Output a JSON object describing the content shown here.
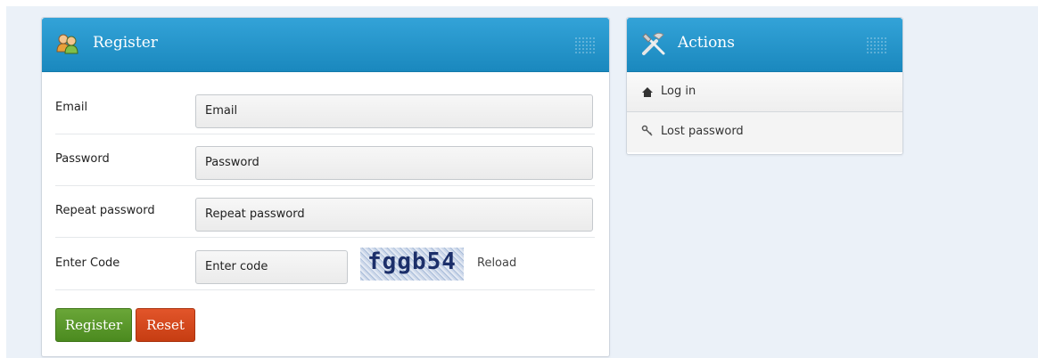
{
  "register": {
    "title": "Register",
    "fields": [
      {
        "label": "Email",
        "placeholder": "Email",
        "value": "Email"
      },
      {
        "label": "Password",
        "placeholder": "Password",
        "value": "Password"
      },
      {
        "label": "Repeat password",
        "placeholder": "Repeat password",
        "value": "Repeat password"
      }
    ],
    "code": {
      "label": "Enter Code",
      "placeholder": "Enter code",
      "value": "Enter code",
      "captcha_text": "fggb54",
      "reload_label": "Reload"
    },
    "buttons": {
      "register_label": "Register",
      "reset_label": "Reset"
    }
  },
  "actions": {
    "title": "Actions",
    "items": [
      {
        "label": "Log in",
        "icon": "home-icon"
      },
      {
        "label": "Lost password",
        "icon": "key-icon"
      }
    ]
  },
  "colors": {
    "header_blue": "#1a88be",
    "register_green": "#4b8a1f",
    "reset_orange": "#c63d12",
    "page_bg": "#ebf1f8"
  }
}
